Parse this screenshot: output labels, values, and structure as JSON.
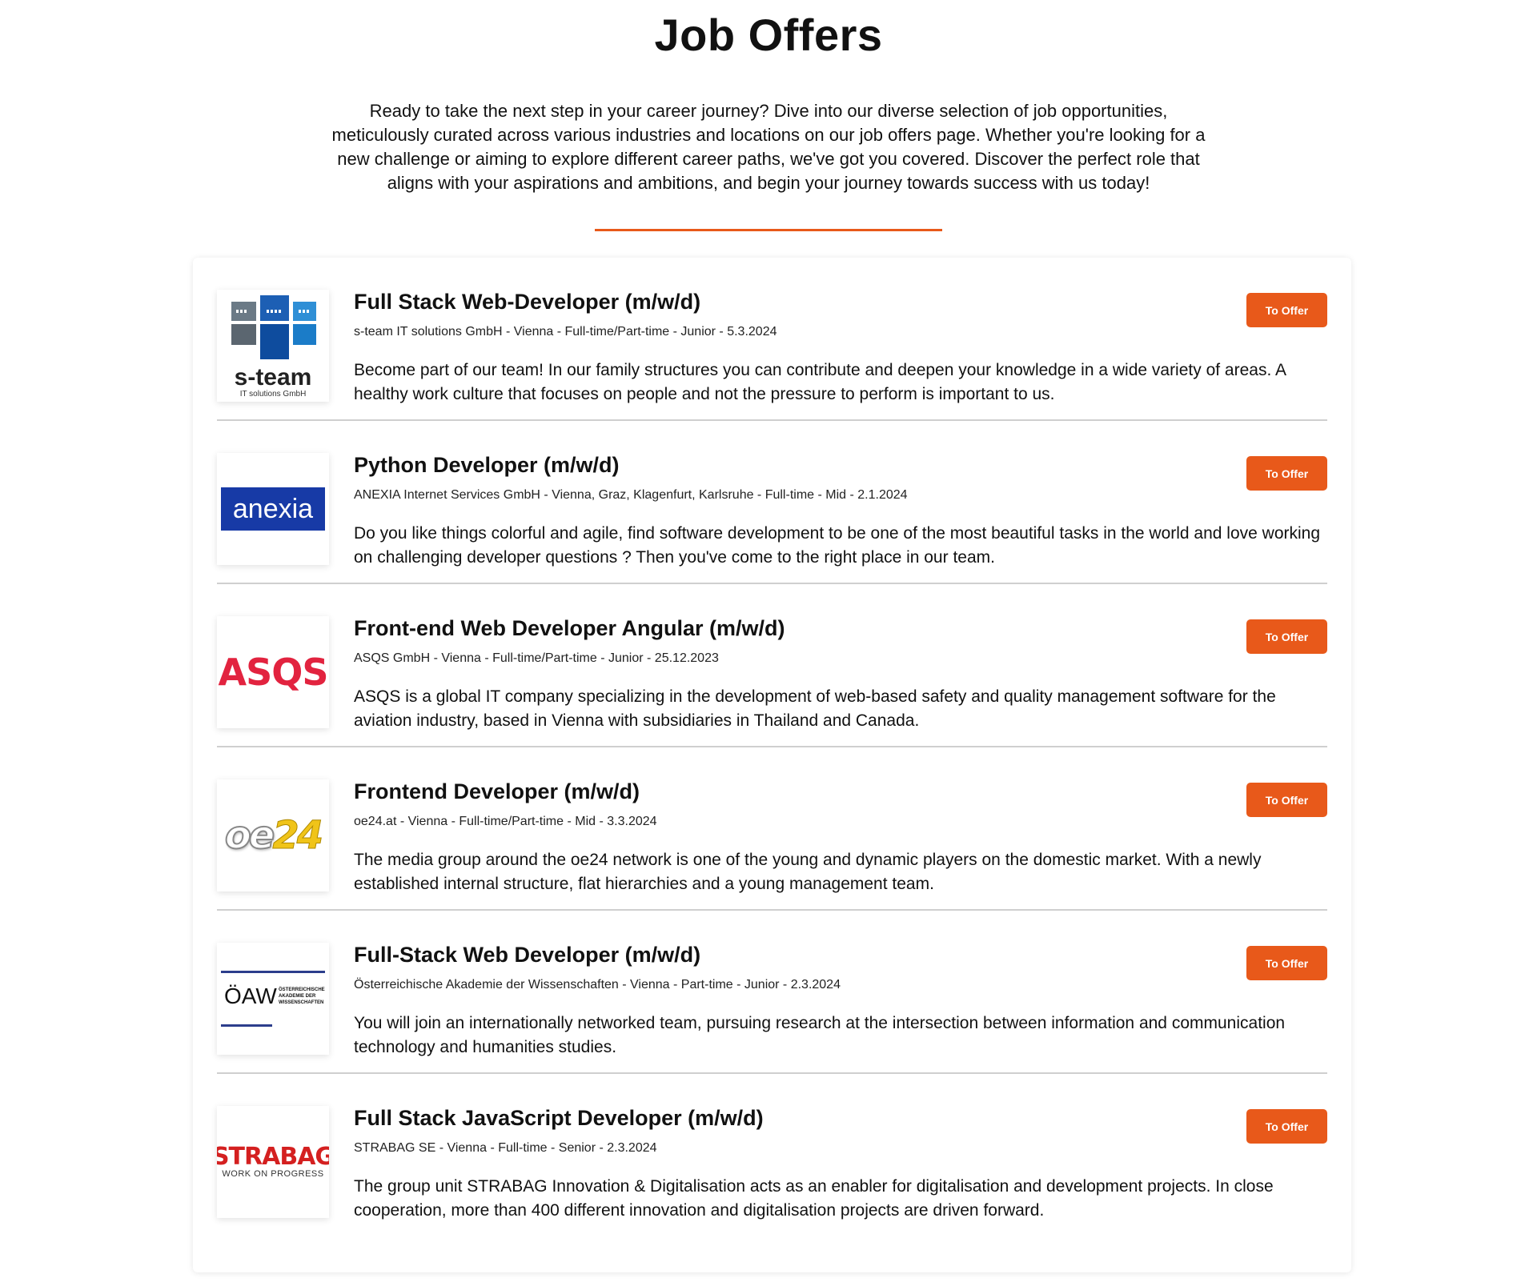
{
  "page": {
    "title": "Job Offers",
    "intro_lines": [
      "Ready to take the next step in your career journey? Dive into our diverse selection of job opportunities,",
      "meticulously curated across various industries and locations on our job offers page. Whether you're looking for a",
      "new challenge or aiming to explore different career paths, we've got you covered. Discover the perfect role that",
      "aligns with your aspirations and ambitions, and begin your journey towards success with us today!"
    ]
  },
  "colors": {
    "accent": "#e8591a",
    "anexia_blue": "#173aa6",
    "asqs_red": "#e2233f",
    "strabag_red": "#d42020"
  },
  "jobs": [
    {
      "title": "Full Stack Web-Developer (m/w/d)",
      "meta": "s-team IT solutions GmbH - Vienna - Full-time/Part-time - Junior - 5.3.2024",
      "description": "Become part of our team! In our family structures you can contribute and deepen your knowledge in a wide variety of areas. A healthy work culture that focuses on people and not the pressure to perform is important to us.",
      "button": "To Offer",
      "logo": {
        "kind": "s-team",
        "name": "s-team",
        "subtitle": "IT solutions GmbH"
      }
    },
    {
      "title": "Python Developer (m/w/d)",
      "meta": "ANEXIA Internet Services GmbH - Vienna, Graz, Klagenfurt, Karlsruhe - Full-time - Mid - 2.1.2024",
      "description": "Do you like things colorful and agile, find software development to be one of the most beautiful tasks in the world and love working on challenging developer questions ? Then you've come to the right place in our team.",
      "button": "To Offer",
      "logo": {
        "kind": "anexia",
        "name": "anexia"
      }
    },
    {
      "title": "Front-end Web Developer Angular (m/w/d)",
      "meta": "ASQS GmbH - Vienna - Full-time/Part-time - Junior - 25.12.2023",
      "description": "ASQS is a global IT company specializing in the development of web-based safety and quality management software for the aviation industry, based in Vienna with subsidiaries in Thailand and Canada.",
      "button": "To Offer",
      "logo": {
        "kind": "asqs",
        "name": "ASQS"
      }
    },
    {
      "title": "Frontend Developer (m/w/d)",
      "meta": "oe24.at - Vienna - Full-time/Part-time - Mid - 3.3.2024",
      "description": "The media group around the oe24 network is one of the young and dynamic players on the domestic market. With a newly established internal structure, flat hierarchies and a young management team.",
      "button": "To Offer",
      "logo": {
        "kind": "oe24",
        "part1": "oe",
        "part2": "24"
      }
    },
    {
      "title": "Full-Stack Web Developer (m/w/d)",
      "meta": "Österreichische Akademie der Wissenschaften - Vienna - Part-time - Junior - 2.3.2024",
      "description": "You will join an internationally networked team, pursuing research at the intersection between information and communication technology and humanities studies.",
      "button": "To Offer",
      "logo": {
        "kind": "oaw",
        "abbr": "ÖAW",
        "full": "ÖSTERREICHISCHE AKADEMIE DER WISSENSCHAFTEN"
      }
    },
    {
      "title": "Full Stack JavaScript Developer (m/w/d)",
      "meta": "STRABAG SE - Vienna - Full-time - Senior - 2.3.2024",
      "description": "The group unit STRABAG Innovation & Digitalisation acts as an enabler for digitalisation and development projects. In close cooperation, more than 400 different innovation and digitalisation projects are driven forward.",
      "button": "To Offer",
      "logo": {
        "kind": "strabag",
        "name": "STRABAG",
        "tagline": "WORK ON PROGRESS"
      }
    }
  ]
}
